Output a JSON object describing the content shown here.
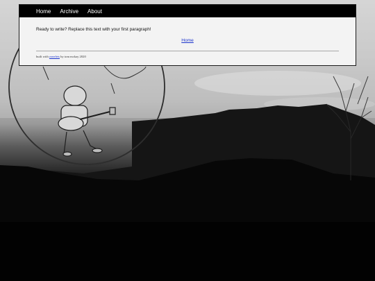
{
  "nav": {
    "items": [
      {
        "label": "Home"
      },
      {
        "label": "Archive"
      },
      {
        "label": "About"
      }
    ]
  },
  "main": {
    "paragraph": "Ready to write? Replace this text with your first paragraph!",
    "home_link": "Home"
  },
  "footer": {
    "prefix": "built with",
    "link_text": "zonelets",
    "suffix": "by tom mckay 2020"
  }
}
